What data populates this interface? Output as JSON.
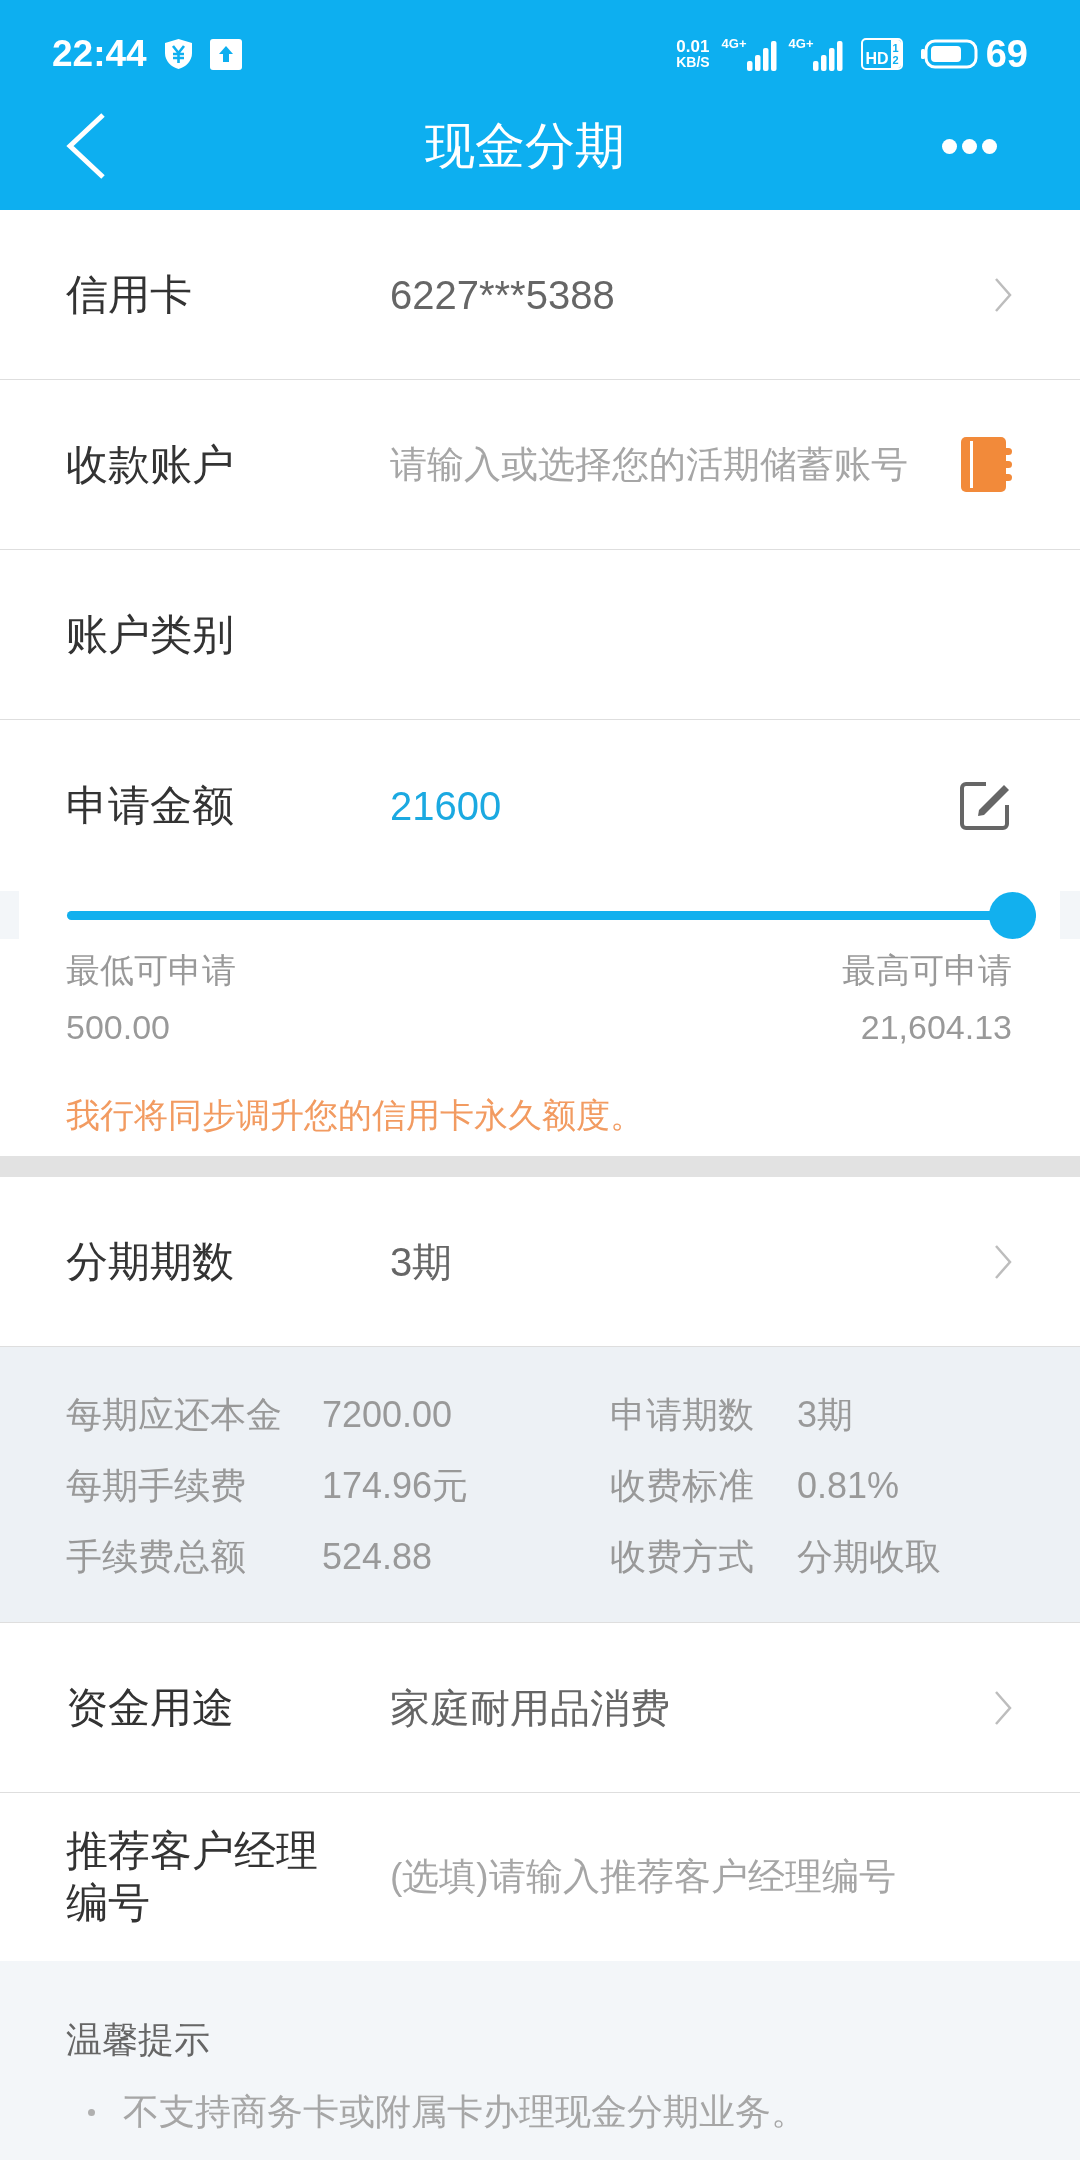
{
  "status_bar": {
    "time": "22:44",
    "net_speed": "0.01",
    "net_speed_unit": "KB/S",
    "networks": [
      {
        "label": "4G+"
      },
      {
        "label": "4G+"
      }
    ],
    "hd": {
      "label": "HD",
      "sims": [
        "1",
        "2"
      ]
    },
    "battery": "69"
  },
  "header": {
    "title": "现金分期"
  },
  "card_rows": [
    {
      "kind": "select",
      "label": "信用卡",
      "value": "6227***5388"
    },
    {
      "kind": "account_input",
      "label": "收款账户",
      "placeholder": "请输入或选择您的活期储蓄账号"
    },
    {
      "kind": "static",
      "label": "账户类别"
    }
  ],
  "amount": {
    "label": "申请金额",
    "value": "21600",
    "slider": {
      "level": 1
    },
    "min_label": "最低可申请",
    "min_value": "500.00",
    "max_label": "最高可申请",
    "max_value": "21,604.13",
    "notice": "我行将同步调升您的信用卡永久额度。"
  },
  "term_row": {
    "kind": "select",
    "label": "分期期数",
    "value": "3期"
  },
  "summary": [
    {
      "label": "每期应还本金",
      "value": "7200.00"
    },
    {
      "label": "申请期数",
      "value": "3期"
    },
    {
      "label": "每期手续费",
      "value": "174.96元"
    },
    {
      "label": "收费标准",
      "value": "0.81%"
    },
    {
      "label": "手续费总额",
      "value": "524.88"
    },
    {
      "label": "收费方式",
      "value": "分期收取"
    }
  ],
  "extra_rows": [
    {
      "kind": "select",
      "label": "资金用途",
      "value": "家庭耐用品消费"
    },
    {
      "kind": "input",
      "label": "推荐客户经理编号",
      "placeholder": "(选填)请输入推荐客户经理编号"
    }
  ],
  "tips": {
    "title": "温馨提示",
    "items": [
      "不支持商务卡或附属卡办理现金分期业务。"
    ]
  }
}
